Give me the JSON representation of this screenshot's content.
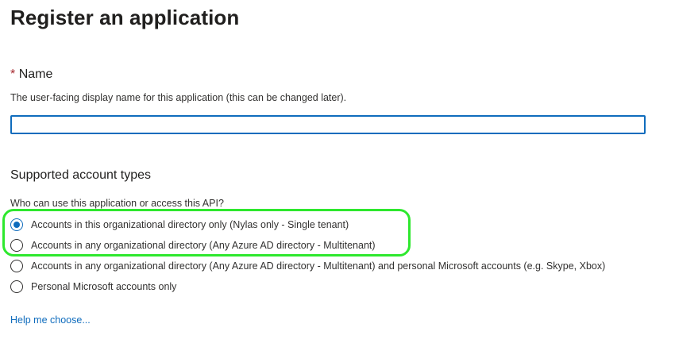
{
  "header": {
    "title": "Register an application",
    "more_label": "···"
  },
  "name_section": {
    "required_marker": "*",
    "label": "Name",
    "help_text": "The user-facing display name for this application (this can be changed later).",
    "input_value": "",
    "input_placeholder": ""
  },
  "account_types": {
    "heading": "Supported account types",
    "question": "Who can use this application or access this API?",
    "options": [
      {
        "label": "Accounts in this organizational directory only (Nylas only - Single tenant)",
        "selected": true
      },
      {
        "label": "Accounts in any organizational directory (Any Azure AD directory - Multitenant)",
        "selected": false
      },
      {
        "label": "Accounts in any organizational directory (Any Azure AD directory - Multitenant) and personal Microsoft accounts (e.g. Skype, Xbox)",
        "selected": false
      },
      {
        "label": "Personal Microsoft accounts only",
        "selected": false
      }
    ],
    "help_link": "Help me choose..."
  },
  "colors": {
    "accent": "#0f6cbd",
    "highlight": "#2ee82e",
    "required": "#a4262c"
  }
}
